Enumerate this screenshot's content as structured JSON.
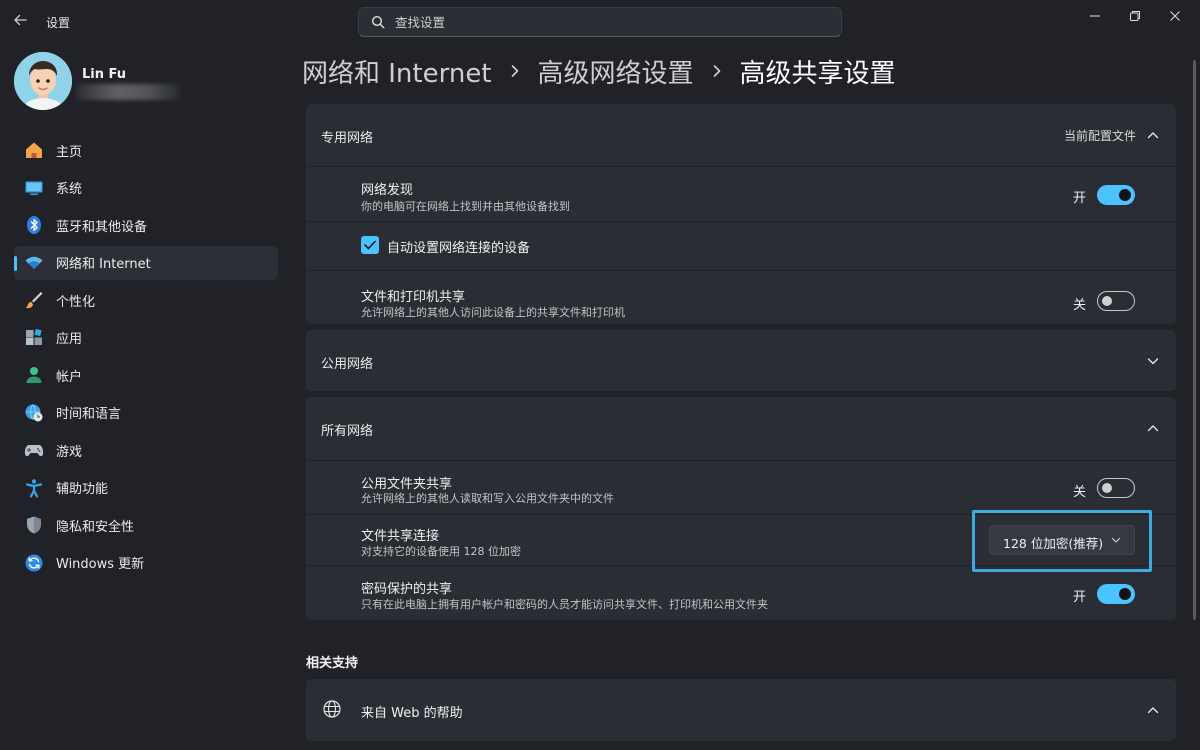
{
  "app": {
    "title": "设置",
    "search_placeholder": "查找设置"
  },
  "user": {
    "name": "Lin Fu"
  },
  "sidebar": {
    "items": [
      {
        "label": "主页",
        "icon": "home-icon"
      },
      {
        "label": "系统",
        "icon": "system-icon"
      },
      {
        "label": "蓝牙和其他设备",
        "icon": "bluetooth-icon"
      },
      {
        "label": "网络和 Internet",
        "icon": "wifi-icon",
        "active": true
      },
      {
        "label": "个性化",
        "icon": "brush-icon"
      },
      {
        "label": "应用",
        "icon": "apps-icon"
      },
      {
        "label": "帐户",
        "icon": "account-icon"
      },
      {
        "label": "时间和语言",
        "icon": "globe-clock-icon"
      },
      {
        "label": "游戏",
        "icon": "gamepad-icon"
      },
      {
        "label": "辅助功能",
        "icon": "accessibility-icon"
      },
      {
        "label": "隐私和安全性",
        "icon": "shield-icon"
      },
      {
        "label": "Windows 更新",
        "icon": "update-icon"
      }
    ]
  },
  "breadcrumb": [
    "网络和 Internet",
    "高级网络设置",
    "高级共享设置"
  ],
  "private_network": {
    "title": "专用网络",
    "badge": "当前配置文件",
    "network_discovery": {
      "title": "网络发现",
      "desc": "你的电脑可在网络上找到并由其他设备找到",
      "state_label": "开",
      "on": true
    },
    "auto_setup": {
      "label": "自动设置网络连接的设备",
      "checked": true
    },
    "file_printer_sharing": {
      "title": "文件和打印机共享",
      "desc": "允许网络上的其他人访问此设备上的共享文件和打印机",
      "state_label": "关",
      "on": false
    }
  },
  "public_network": {
    "title": "公用网络"
  },
  "all_networks": {
    "title": "所有网络",
    "public_folder_sharing": {
      "title": "公用文件夹共享",
      "desc": "允许网络上的其他人读取和写入公用文件夹中的文件",
      "state_label": "关",
      "on": false
    },
    "file_sharing_connections": {
      "title": "文件共享连接",
      "desc": "对支持它的设备使用 128 位加密",
      "selected": "128 位加密(推荐)"
    },
    "password_protected_sharing": {
      "title": "密码保护的共享",
      "desc": "只有在此电脑上拥有用户帐户和密码的人员才能访问共享文件、打印机和公用文件夹",
      "state_label": "开",
      "on": true
    }
  },
  "related": {
    "heading": "相关支持",
    "web_help": "来自 Web 的帮助"
  },
  "colors": {
    "accent": "#4cc2ff",
    "background": "#202228",
    "card": "#2b2d35",
    "highlight": "#3fa9e0"
  }
}
